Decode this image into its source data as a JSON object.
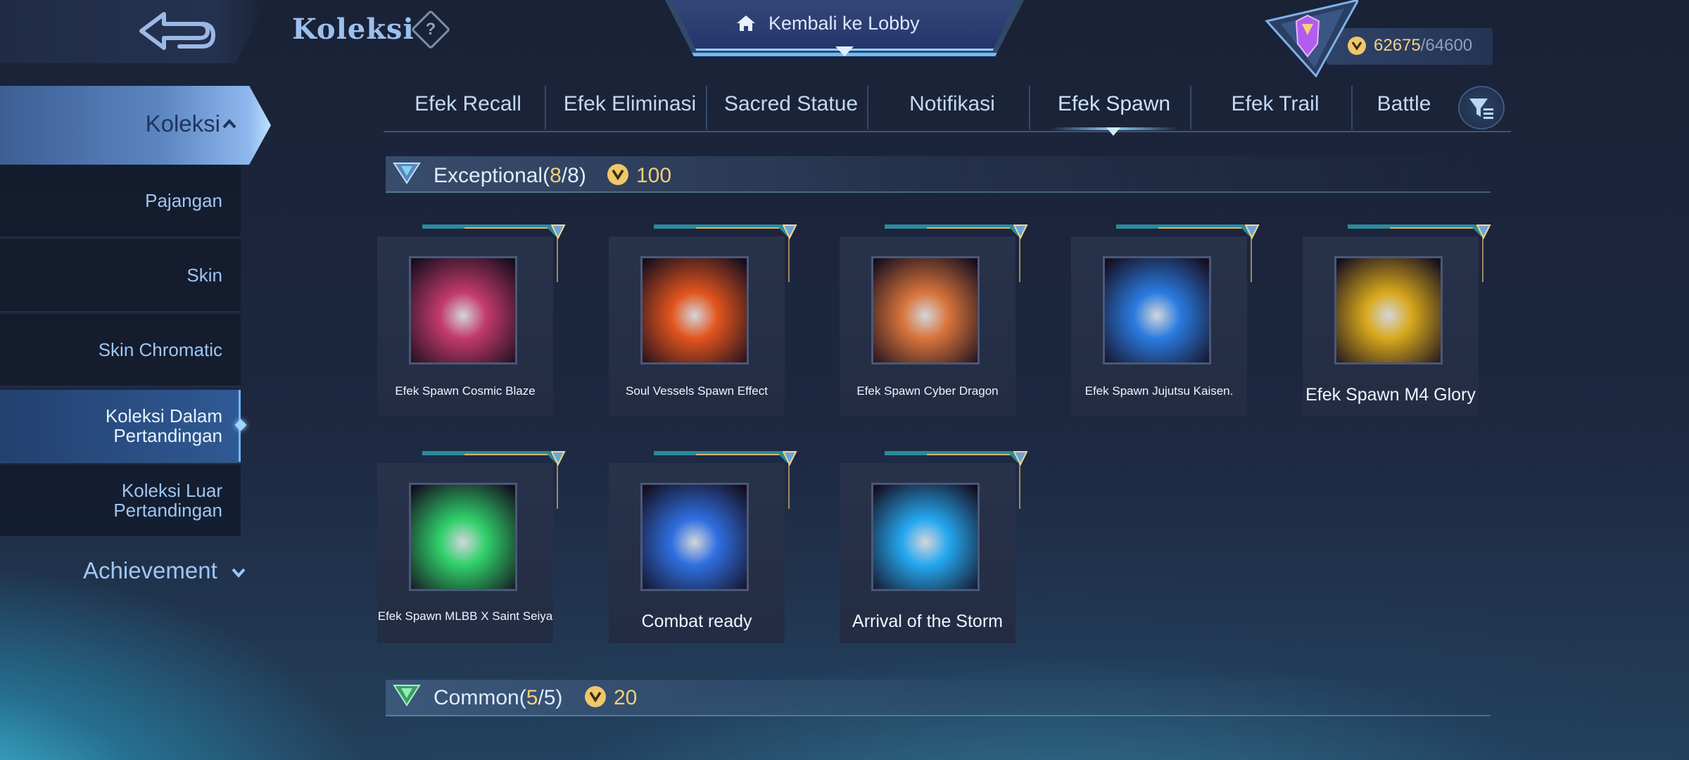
{
  "header": {
    "title": "Koleksi",
    "help": "?",
    "lobby_label": "Kembali ke Lobby",
    "points_current": "62675",
    "points_total": "/64600"
  },
  "sidebar": {
    "main": "Koleksi",
    "items": [
      {
        "label": "Pajangan"
      },
      {
        "label": "Skin"
      },
      {
        "label": "Skin Chromatic"
      },
      {
        "label": "Koleksi Dalam Pertandingan",
        "selected": true
      },
      {
        "label": "Koleksi Luar Pertandingan"
      }
    ],
    "achievement": "Achievement"
  },
  "tabs": [
    "Efek Recall",
    "Efek Eliminasi",
    "Sacred Statue",
    "Notifikasi",
    "Efek Spawn",
    "Efek Trail",
    "Battle"
  ],
  "active_tab": "Efek Spawn",
  "sections": {
    "exceptional": {
      "title": "Exceptional",
      "count_open": "(",
      "count": "8",
      "count_sep": "/",
      "count_total": "8",
      "count_close": ")",
      "points": "100"
    },
    "common": {
      "title": "Common",
      "count_open": "(",
      "count": "5",
      "count_sep": "/",
      "count_total": "5",
      "count_close": ")",
      "points": "20"
    }
  },
  "cards": [
    {
      "name": "Efek Spawn Cosmic Blaze",
      "color": "#c23a6a"
    },
    {
      "name": "Soul Vessels Spawn Effect",
      "color": "#e2541d"
    },
    {
      "name": "Efek Spawn Cyber Dragon",
      "color": "#d8743b"
    },
    {
      "name": "Efek Spawn Jujutsu Kaisen.",
      "color": "#2a7be0"
    },
    {
      "name": "Efek Spawn M4 Glory",
      "color": "#d8a81c"
    },
    {
      "name": "Efek Spawn MLBB X Saint Seiya",
      "color": "#2fd06a"
    },
    {
      "name": "Combat ready",
      "color": "#2f6fe0"
    },
    {
      "name": "Arrival of the Storm",
      "color": "#25a8f0"
    }
  ],
  "colors": {
    "accent": "#6fb8ff",
    "gold": "#f4cd7a"
  }
}
